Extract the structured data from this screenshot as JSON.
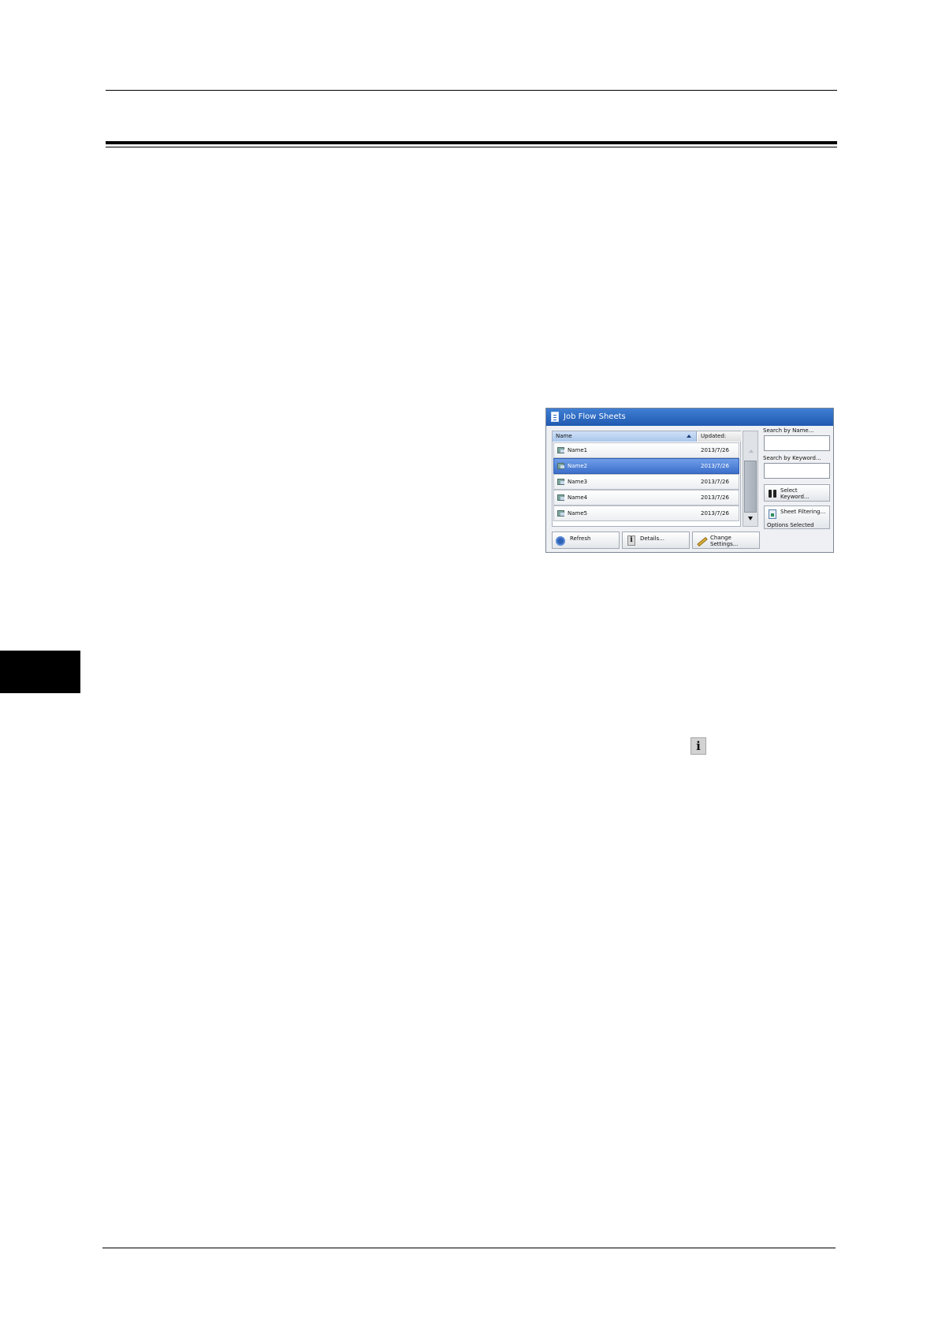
{
  "screen": {
    "title": "Job Flow Sheets",
    "columns": {
      "name": "Name",
      "updated": "Updated:"
    },
    "rows": [
      {
        "name": "Name1",
        "date": "2013/7/26",
        "selected": false
      },
      {
        "name": "Name2",
        "date": "2013/7/26",
        "selected": true
      },
      {
        "name": "Name3",
        "date": "2013/7/26",
        "selected": false
      },
      {
        "name": "Name4",
        "date": "2013/7/26",
        "selected": false
      },
      {
        "name": "Name5",
        "date": "2013/7/26",
        "selected": false
      }
    ],
    "search_by_name": "Search by Name...",
    "search_by_keyword": "Search by Keyword...",
    "select_keyword": [
      "Select",
      "Keyword..."
    ],
    "sheet_filtering": "Sheet Filtering...",
    "options_selected": "Options Selected",
    "refresh": "Refresh",
    "details": "Details...",
    "change_settings": [
      "Change",
      "Settings..."
    ]
  },
  "inline_icon": {
    "glyph": "i"
  },
  "colors": {
    "titlebar": "#2a66c0",
    "selected_row": "#3c6fcb",
    "chapter_tab": "#000000"
  }
}
